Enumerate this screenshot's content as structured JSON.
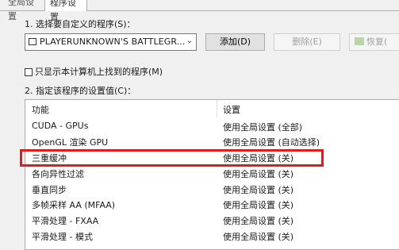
{
  "tabs": [
    "全局设置",
    "程序设置"
  ],
  "section1_label": "1. 选择要自定义的程序(S)：",
  "program_select": {
    "value": "PLAYERUNKNOWN'S BATTLEGR...",
    "arrow": "⌄"
  },
  "buttons": {
    "add": "添加(D)",
    "remove": "删除(E)",
    "restore": "恢复("
  },
  "show_only_checkbox": "只显示本计算机上找到的程序(M)",
  "section2_label": "2. 指定该程序的设置值(C)：",
  "table": {
    "headers": [
      "功能",
      "设置"
    ],
    "rows": [
      {
        "feature": "CUDA - GPUs",
        "setting": "使用全局设置 (全部)"
      },
      {
        "feature": "OpenGL 渲染 GPU",
        "setting": "使用全局设置 (自动选择)"
      },
      {
        "feature": "三重缓冲",
        "setting": "使用全局设置 (关)"
      },
      {
        "feature": "各向异性过滤",
        "setting": "使用全局设置 (关)"
      },
      {
        "feature": "垂直同步",
        "setting": "使用全局设置 (关)"
      },
      {
        "feature": "多帧采样 AA (MFAA)",
        "setting": "使用全局设置 (关)"
      },
      {
        "feature": "平滑处理 - FXAA",
        "setting": "使用全局设置 (关)"
      },
      {
        "feature": "平滑处理 - 模式",
        "setting": "使用全局设置 (关)"
      }
    ]
  },
  "colors": {
    "highlight": "#e51a1a"
  }
}
